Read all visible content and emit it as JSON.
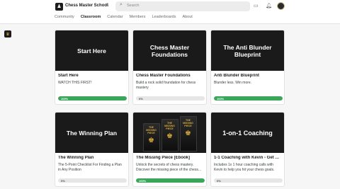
{
  "header": {
    "brand": "Chess Master School",
    "search_placeholder": "Search",
    "icons": [
      "chat-icon",
      "bell-icon",
      "avatar"
    ]
  },
  "tabs": [
    "Community",
    "Classroom",
    "Calendar",
    "Members",
    "Leaderboards",
    "About"
  ],
  "active_tab": "Classroom",
  "courses": [
    {
      "thumb": "Start Here",
      "title": "Start Here",
      "desc": "WATCH THIS FIRST!",
      "progress": 100,
      "progress_label": "100%"
    },
    {
      "thumb": "Chess Master Foundations",
      "title": "Chess Master Foundations",
      "desc": "Build a rock solid foundation for chess mastery",
      "progress": 0,
      "progress_label": "0%"
    },
    {
      "thumb": "The Anti Blunder Blueprint",
      "title": "Anti Blunder Blueprint",
      "desc": "Blunder less. Win more.",
      "progress": 100,
      "progress_label": "100%"
    },
    {
      "thumb": "The Winning Plan",
      "title": "The Winning Plan",
      "desc": "The 5-Point Checklist For Finding a Plan in Any Position",
      "progress": 0,
      "progress_label": "0%"
    },
    {
      "thumb": "THE MISSING PIECE",
      "title": "The Missing Piece [Ebook]",
      "desc": "Unlock the secrets of chess mastery. Discover the missing piece of the chess...",
      "progress": 100,
      "progress_label": "100%"
    },
    {
      "thumb": "1-on-1 Coaching",
      "title": "1-1 Coaching with Kevin - Get A B...",
      "desc": "Includes 1x 1 hour coaching calls with Kevin to help you hit your chess goals.",
      "progress": 0,
      "progress_label": "0%"
    }
  ],
  "colors": {
    "progress_complete": "#3aa65a",
    "thumb_bg": "#1a1a1a"
  }
}
